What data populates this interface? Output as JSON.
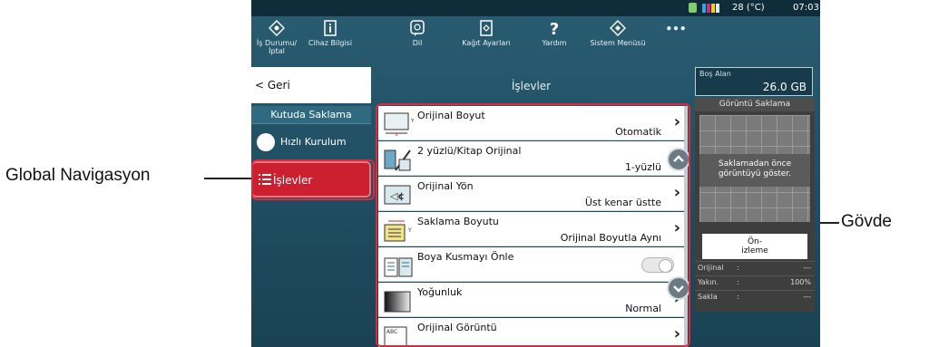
{
  "callouts": {
    "left": "Global Navigasyon",
    "right": "Gövde"
  },
  "status": {
    "temperature": "28 (°C)",
    "time": "07:03"
  },
  "toolbar": {
    "items": [
      {
        "label": "İş Durumu/\nİptal",
        "icon": "job-status-icon"
      },
      {
        "label": "Cihaz Bilgisi",
        "icon": "device-info-icon"
      },
      {
        "label": "Dil",
        "icon": "language-icon"
      },
      {
        "label": "Kağıt Ayarları",
        "icon": "paper-settings-icon"
      },
      {
        "label": "Yardım",
        "icon": "help-icon"
      },
      {
        "label": "Sistem Menüsü",
        "icon": "system-menu-icon"
      }
    ],
    "more": "•••"
  },
  "nav": {
    "back": "< Geri",
    "section": "Kutuda Saklama",
    "quick": "Hızlı Kurulum",
    "functions": "İşlevler"
  },
  "content": {
    "title": "İşlevler",
    "rows": [
      {
        "title": "Orijinal Boyut",
        "value": "Otomatik"
      },
      {
        "title": "2 yüzlü/Kitap Orijinal",
        "value": "1-yüzlü"
      },
      {
        "title": "Orijinal Yön",
        "value": "Üst kenar üstte"
      },
      {
        "title": "Saklama Boyutu",
        "value": "Orijinal Boyutla Aynı"
      },
      {
        "title": "Boya Kusmayı Önle",
        "value": ""
      },
      {
        "title": "Yoğunluk",
        "value": "Normal"
      },
      {
        "title": "Orijinal Görüntü",
        "value": ""
      }
    ]
  },
  "panel": {
    "free_label": "Boş Alan",
    "free_value": "26.0 GB",
    "preview_title": "Görüntü Saklama",
    "preview_msg": "Saklamadan önce görüntüyü göster.",
    "preview_btn": "Ön-\nizleme",
    "info": [
      {
        "label": "Orijinal",
        "value": "---"
      },
      {
        "label": "Yakın.",
        "value": "100%"
      },
      {
        "label": "Sakla",
        "value": "---"
      }
    ]
  },
  "colors": {
    "screen_bg": "#245468",
    "accent_red": "#cc2030",
    "frame_red": "#e0283a"
  }
}
